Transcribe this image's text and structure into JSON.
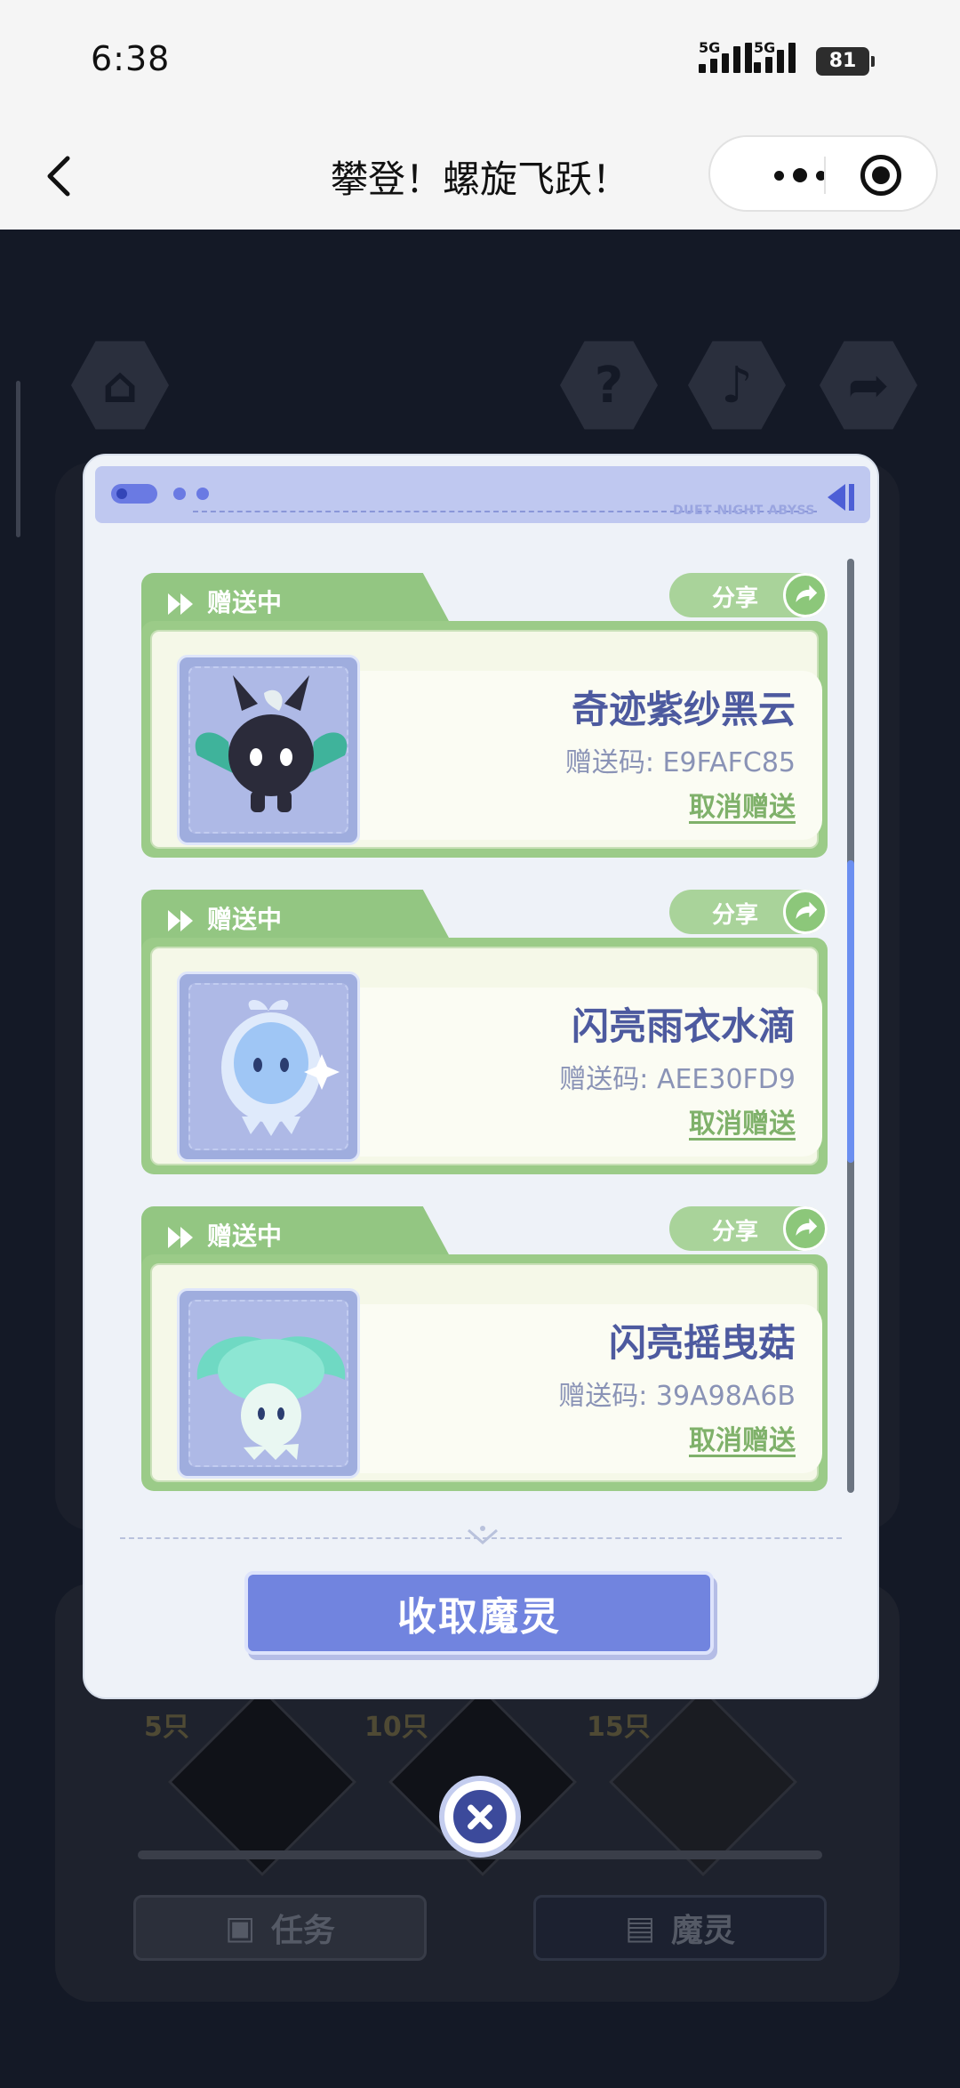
{
  "status": {
    "time": "6:38",
    "signal1": "5G",
    "signal2": "5G",
    "battery": "81"
  },
  "titlebar": {
    "title": "攀登！螺旋飞跃！"
  },
  "background": {
    "brand": "DUET NIGHT ABYSS",
    "milestones": [
      "5只",
      "10只",
      "15只"
    ],
    "task_button": "任务",
    "spirit_button": "魔灵"
  },
  "modal": {
    "gifts": [
      {
        "status": "赠送中",
        "share": "分享",
        "name": "奇迹紫纱黑云",
        "code": "赠送码: E9FAFC85",
        "cancel": "取消赠送"
      },
      {
        "status": "赠送中",
        "share": "分享",
        "name": "闪亮雨衣水滴",
        "code": "赠送码: AEE30FD9",
        "cancel": "取消赠送"
      },
      {
        "status": "赠送中",
        "share": "分享",
        "name": "闪亮摇曳菇",
        "code": "赠送码: 39A98A6B",
        "cancel": "取消赠送"
      }
    ],
    "collect_button": "收取魔灵"
  },
  "colors": {
    "accent": "#7184df",
    "card_green": "#93c682",
    "name_text": "#4d5a9f",
    "cancel_text": "#7fb16a"
  }
}
